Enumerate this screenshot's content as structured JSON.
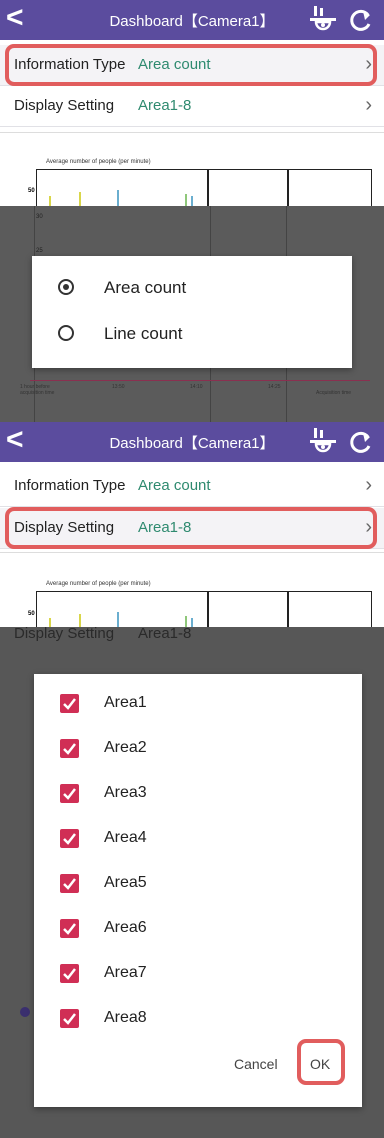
{
  "app_bar": {
    "back_icon": "chevron-left-icon",
    "title": "Dashboard【Camera1】",
    "camera_icon": "camera-icon",
    "refresh_icon": "refresh-icon"
  },
  "settings": {
    "info_type_label": "Information Type",
    "info_type_value": "Area count",
    "display_label": "Display Setting",
    "display_value": "Area1-8",
    "chevron": "›"
  },
  "chart": {
    "title": "Average number of people (per minute)",
    "y_ticks": [
      "50",
      "30",
      "25"
    ],
    "x_ticks": [
      "1 hour before\nacquisition time",
      "13:50",
      "14:10",
      "14:25",
      "Acquisition time"
    ]
  },
  "info_type_dialog": {
    "options": [
      {
        "label": "Area count",
        "selected": true
      },
      {
        "label": "Line count",
        "selected": false
      }
    ]
  },
  "display_dialog": {
    "background_row_label": "Display Setting",
    "background_row_value": "Area1-8",
    "items": [
      {
        "label": "Area1",
        "checked": true
      },
      {
        "label": "Area2",
        "checked": true
      },
      {
        "label": "Area3",
        "checked": true
      },
      {
        "label": "Area4",
        "checked": true
      },
      {
        "label": "Area5",
        "checked": true
      },
      {
        "label": "Area6",
        "checked": true
      },
      {
        "label": "Area7",
        "checked": true
      },
      {
        "label": "Area8",
        "checked": true
      }
    ],
    "cancel_label": "Cancel",
    "ok_label": "OK"
  },
  "colors": {
    "app_bar": "#5b4c9e",
    "highlight": "#e15d5d",
    "value_text": "#2e8a6f",
    "checkbox": "#d02e55",
    "bar_yellow": "#d9d64a",
    "bar_blue": "#6aaecf",
    "bar_green": "#8fc77a"
  }
}
